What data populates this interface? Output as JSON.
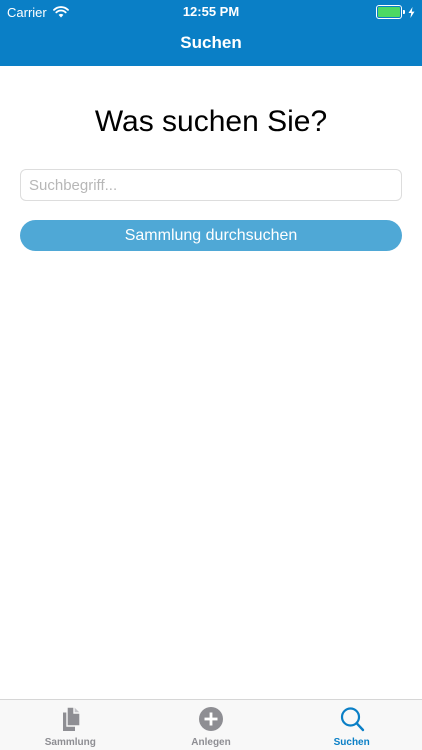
{
  "status_bar": {
    "carrier": "Carrier",
    "time": "12:55 PM",
    "battery_level": 1.0
  },
  "navigation": {
    "title": "Suchen"
  },
  "main": {
    "heading": "Was suchen Sie?",
    "search_field": {
      "placeholder": "Suchbegriff...",
      "value": ""
    },
    "search_button_label": "Sammlung durchsuchen"
  },
  "tab_bar": {
    "tabs": [
      {
        "label": "Sammlung",
        "icon": "documents-icon",
        "selected": false
      },
      {
        "label": "Anlegen",
        "icon": "add-circle-icon",
        "selected": false
      },
      {
        "label": "Suchen",
        "icon": "search-icon",
        "selected": true
      }
    ]
  },
  "colors": {
    "header_background": "#0a7fc6",
    "button_background": "#4fa8d6",
    "tab_active": "#0a7fc6",
    "tab_inactive": "#8e8e93",
    "battery": "#4cd964"
  }
}
